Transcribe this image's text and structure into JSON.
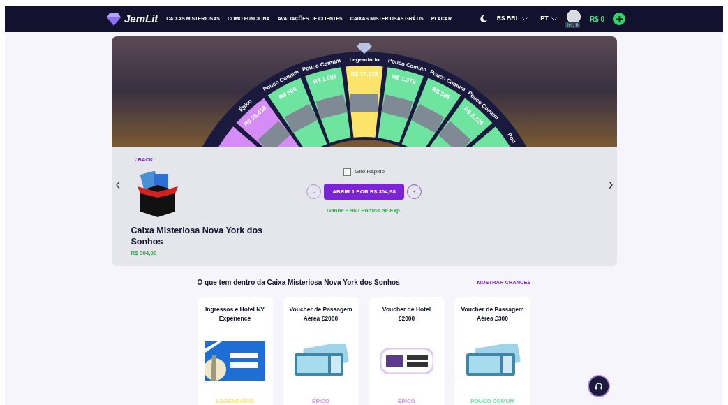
{
  "nav": {
    "logo": "JemLit",
    "links": [
      "CAIXAS MISTERIOSAS",
      "COMO FUNCIONA",
      "AVALIAÇÕES DE CLIENTES",
      "CAIXAS MISTERIOSAS GRÁTIS",
      "PLACAR"
    ],
    "currency": "R$ BRL",
    "language": "PT",
    "level": "lvl. 0",
    "balance": "R$ 0"
  },
  "wheel": {
    "segments": [
      {
        "color": "#d58cf5"
      },
      {
        "label": "Épico",
        "price": "R$ 15.418",
        "color": "#d58cf5"
      },
      {
        "label": "Pouco Comum",
        "price": "R$ 508",
        "color": "#6fe3a0"
      },
      {
        "label": "Pouco Comum",
        "price": "R$ 1.001",
        "color": "#6fe3a0"
      },
      {
        "label": "Legendário",
        "price": "R$ 77.015",
        "color": "#fce36a"
      },
      {
        "label": "Pouco Comum",
        "price": "R$ 1.379",
        "color": "#6fe3a0"
      },
      {
        "label": "Pouco Comum",
        "price": "R$ 385",
        "color": "#6fe3a0"
      },
      {
        "label": "Pouco Comum",
        "price": "R$ 2.226",
        "color": "#6fe3a0"
      },
      {
        "label": "Pou",
        "color": "#6fe3a0"
      }
    ]
  },
  "box": {
    "back": "BACK",
    "title": "Caixa Misteriosa Nova York dos Sonhos",
    "price": "R$ 304,98",
    "quick_spin": {
      "label": "Giro Rápido",
      "checked": false
    },
    "minus": "-",
    "open_button": "ABRIR 1 POR R$ 304,98",
    "plus": "+",
    "xp": "Ganhe 3.960 Pontos de Exp."
  },
  "contents": {
    "heading": "O que tem dentro da Caixa Misteriosa Nova York dos Sonhos",
    "show_odds": "MOSTRAR CHANCES",
    "items": [
      {
        "name": "Ingressos e Hotel NY Experience",
        "kind": "gift-card",
        "rarity": "LEGENDÁRIO",
        "color": "#fce36a"
      },
      {
        "name": "Voucher de Passagem Aérea £2000",
        "kind": "ticket",
        "rarity": "ÉPICO",
        "color": "#d58cf5"
      },
      {
        "name": "Voucher de Hotel £2000",
        "kind": "hotel-voucher",
        "rarity": "ÉPICO",
        "color": "#d58cf5"
      },
      {
        "name": "Voucher de Passagem Aérea £300",
        "kind": "ticket",
        "rarity": "POUCO COMUM",
        "color": "#6fe3a0"
      }
    ]
  }
}
